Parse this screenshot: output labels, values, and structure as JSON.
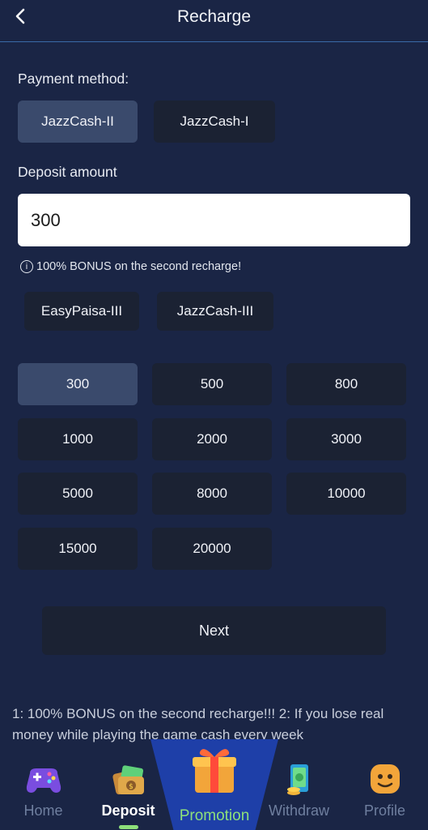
{
  "header": {
    "title": "Recharge"
  },
  "payment": {
    "label": "Payment method:",
    "methods": [
      "JazzCash-II",
      "JazzCash-I"
    ],
    "selected": "JazzCash-II"
  },
  "deposit": {
    "label": "Deposit amount",
    "value": "300",
    "bonus_note": "100% BONUS on the second recharge!",
    "channels": [
      "EasyPaisa-III",
      "JazzCash-III"
    ],
    "amounts": [
      "300",
      "500",
      "800",
      "1000",
      "2000",
      "3000",
      "5000",
      "8000",
      "10000",
      "15000",
      "20000"
    ],
    "selected_amount": "300"
  },
  "next_label": "Next",
  "notice": "1: 100% BONUS on the second recharge!!! 2: If you lose real money while playing the game cash every week",
  "tabs": {
    "home": "Home",
    "deposit": "Deposit",
    "promotion": "Promotion",
    "withdraw": "Withdraw",
    "profile": "Profile",
    "active": "Deposit"
  },
  "colors": {
    "background": "#1a2545",
    "selected_button": "#3a4a6c",
    "button": "#1b2233",
    "header_divider": "#3a6aa8",
    "promotion_highlight": "#1e3fa8",
    "accent_green": "#8ee07a"
  },
  "icons": {
    "back": "chevron-left-icon",
    "info": "info-icon",
    "home": "gamepad-icon",
    "deposit": "wallet-icon",
    "promotion": "gift-box-icon",
    "withdraw": "money-icon",
    "profile": "avatar-face-icon"
  }
}
